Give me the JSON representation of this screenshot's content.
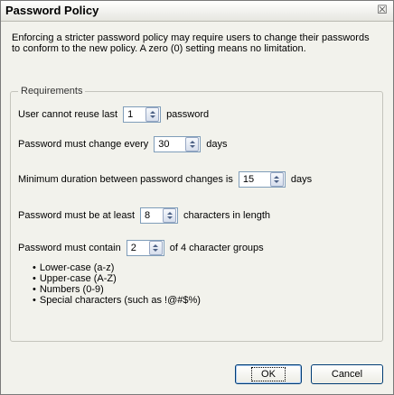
{
  "dialog": {
    "title": "Password Policy",
    "close_glyph": "☒",
    "description": "Enforcing a stricter password policy may require users to change their passwords to conform to the new policy. A zero (0) setting means no limitation."
  },
  "requirements": {
    "legend": "Requirements",
    "reuse": {
      "label": "User cannot reuse last",
      "value": "1",
      "suffix": "password"
    },
    "change_every": {
      "label": "Password must change every",
      "value": "30",
      "suffix": "days"
    },
    "min_duration": {
      "label": "Minimum duration between password changes is",
      "value": "15",
      "suffix": "days"
    },
    "min_length": {
      "label": "Password must be at least",
      "value": "8",
      "suffix": "characters in length"
    },
    "groups": {
      "label": "Password must contain",
      "value": "2",
      "suffix": "of 4 character groups"
    },
    "group_list": [
      "Lower-case (a-z)",
      "Upper-case (A-Z)",
      "Numbers (0-9)",
      "Special characters (such as !@#$%)"
    ]
  },
  "buttons": {
    "ok": "OK",
    "cancel": "Cancel"
  },
  "icons": {
    "close": "close-icon",
    "spin": "spin-up-down-icon"
  }
}
